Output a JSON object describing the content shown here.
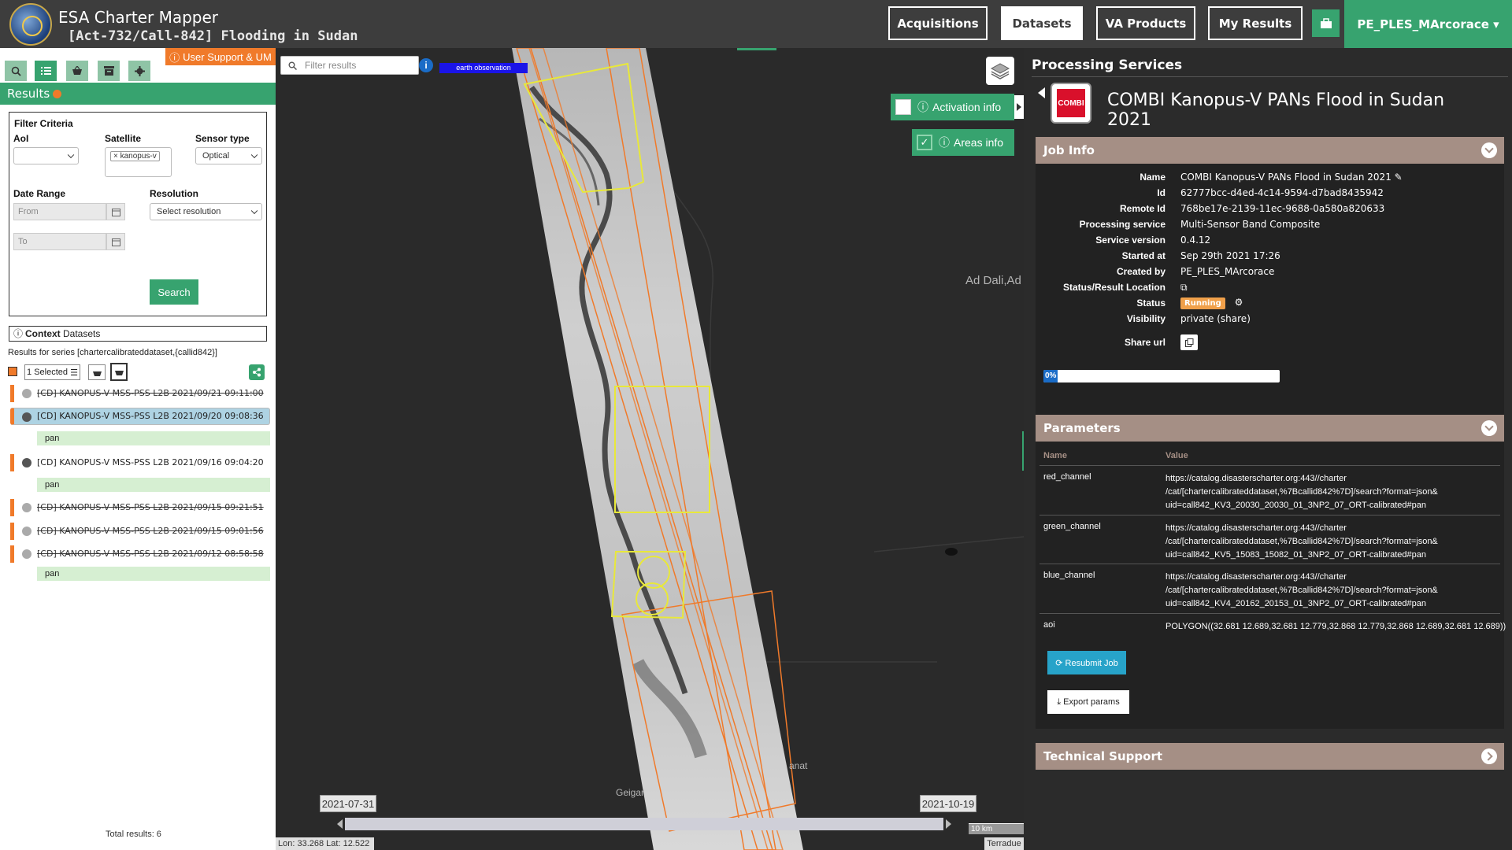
{
  "header": {
    "title": "ESA Charter Mapper",
    "subtitle": "[Act-732/Call-842] Flooding in Sudan",
    "nav": [
      "Acquisitions",
      "Datasets",
      "VA Products",
      "My Results"
    ],
    "active_nav": "Datasets",
    "user": "PE_PLES_MArcorace ▾"
  },
  "left": {
    "support_label": "User Support & UM",
    "results_label": "Results",
    "filter": {
      "title": "Filter Criteria",
      "aoi_label": "AoI",
      "satellite_label": "Satellite",
      "satellite_chip": "kanopus-v",
      "sensor_label": "Sensor type",
      "sensor_value": "Optical",
      "date_label": "Date Range",
      "from_placeholder": "From",
      "to_placeholder": "To",
      "resolution_label": "Resolution",
      "resolution_value": "Select resolution",
      "search_label": "Search"
    },
    "context_label": "Context",
    "context_rest": " Datasets",
    "series_text": "Results for series [chartercalibrateddataset,{callid842}]",
    "selected_label": "1 Selected",
    "results": [
      {
        "label": "[CD] KANOPUS-V MSS-PSS L2B 2021/09/21 09:11:00"
      },
      {
        "label": "[CD] KANOPUS-V MSS-PSS L2B 2021/09/20 09:08:36"
      },
      {
        "label": "[CD] KANOPUS-V MSS-PSS L2B 2021/09/16 09:04:20"
      },
      {
        "label": "[CD] KANOPUS-V MSS-PSS L2B 2021/09/15 09:21:51"
      },
      {
        "label": "[CD] KANOPUS-V MSS-PSS L2B 2021/09/15 09:01:56"
      },
      {
        "label": "[CD] KANOPUS-V MSS-PSS L2B 2021/09/12 08:58:58"
      }
    ],
    "pan_label": "pan",
    "total": "Total results: 6"
  },
  "map": {
    "filter_placeholder": "Filter results",
    "eo_tag": "earth observation",
    "activation_label": "Activation info",
    "areas_label": "Areas info",
    "place_1": "Ad Dali,Ad",
    "place_2": "Geigar",
    "place_3": "anat",
    "time_start": "2021-07-31",
    "time_end": "2021-10-19",
    "scale": "10 km",
    "coords": "Lon: 33.268 Lat: 12.522",
    "attribution": "Terradue"
  },
  "right": {
    "title": "Processing Services",
    "job_name": "COMBI Kanopus-V PANs Flood in Sudan 2021",
    "icon_text": "COMBI",
    "job_info_label": "Job Info",
    "info": [
      {
        "k": "Name",
        "v": "COMBI Kanopus-V PANs Flood in Sudan 2021 ✎"
      },
      {
        "k": "Id",
        "v": "62777bcc-d4ed-4c14-9594-d7bad8435942"
      },
      {
        "k": "Remote Id",
        "v": "768be17e-2139-11ec-9688-0a580a820633"
      },
      {
        "k": "Processing service",
        "v": "Multi-Sensor Band Composite"
      },
      {
        "k": "Service version",
        "v": "0.4.12"
      },
      {
        "k": "Started at",
        "v": "Sep 29th 2021 17:26"
      },
      {
        "k": "Created by",
        "v": "PE_PLES_MArcorace"
      },
      {
        "k": "Status/Result Location",
        "v": "⧉"
      }
    ],
    "status_label": "Status",
    "status_value": "Running",
    "visibility_label": "Visibility",
    "visibility_value": "private (share)",
    "share_label": "Share url",
    "progress": "0%",
    "params_label": "Parameters",
    "param_name_head": "Name",
    "param_value_head": "Value",
    "params": [
      {
        "name": "red_channel",
        "value": "https://catalog.disasterscharter.org:443//charter\n/cat/[chartercalibrateddataset,%7Bcallid842%7D]/search?format=json&\nuid=call842_KV3_20030_20030_01_3NP2_07_ORT-calibrated#pan"
      },
      {
        "name": "green_channel",
        "value": "https://catalog.disasterscharter.org:443//charter\n/cat/[chartercalibrateddataset,%7Bcallid842%7D]/search?format=json&\nuid=call842_KV5_15083_15082_01_3NP2_07_ORT-calibrated#pan"
      },
      {
        "name": "blue_channel",
        "value": "https://catalog.disasterscharter.org:443//charter\n/cat/[chartercalibrateddataset,%7Bcallid842%7D]/search?format=json&\nuid=call842_KV4_20162_20153_01_3NP2_07_ORT-calibrated#pan"
      },
      {
        "name": "aoi",
        "value": "POLYGON((32.681 12.689,32.681 12.779,32.868 12.779,32.868 12.689,32.681 12.689))"
      }
    ],
    "resubmit_label": "⟳ Resubmit Job",
    "export_label": "⤓ Export params",
    "tech_label": "Technical Support"
  }
}
